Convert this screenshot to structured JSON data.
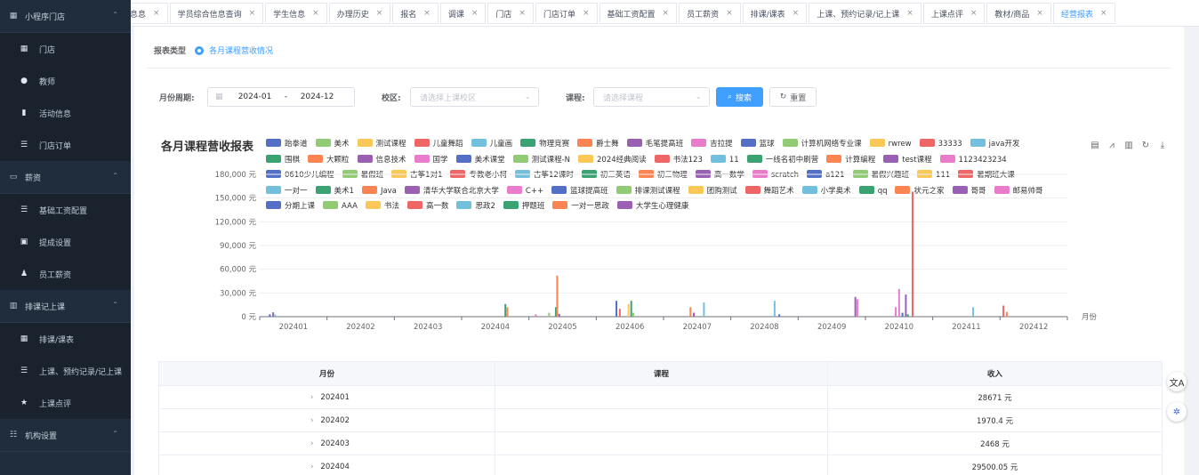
{
  "sidebar": {
    "items": [
      {
        "type": "group",
        "label": "小程序门店",
        "icon": "grid-icon",
        "chev": "⌃"
      },
      {
        "type": "item",
        "label": "门店",
        "icon": "table-icon"
      },
      {
        "type": "item",
        "label": "教师",
        "icon": "user-icon"
      },
      {
        "type": "item",
        "label": "活动信息",
        "icon": "info-icon"
      },
      {
        "type": "item",
        "label": "门店订单",
        "icon": "list-icon"
      },
      {
        "type": "group",
        "label": "薪资",
        "icon": "wallet-icon",
        "chev": "⌃"
      },
      {
        "type": "item",
        "label": "基础工资配置",
        "icon": "list-icon"
      },
      {
        "type": "item",
        "label": "提成设置",
        "icon": "doc-icon"
      },
      {
        "type": "item",
        "label": "员工薪资",
        "icon": "user-money-icon"
      },
      {
        "type": "group",
        "label": "排课记上课",
        "icon": "calendar-icon",
        "chev": "⌃"
      },
      {
        "type": "item",
        "label": "排课/课表",
        "icon": "grid-icon"
      },
      {
        "type": "item",
        "label": "上课、预约记录/记上课",
        "icon": "list-icon"
      },
      {
        "type": "item",
        "label": "上课点评",
        "icon": "star-icon"
      },
      {
        "type": "group",
        "label": "机构设置",
        "icon": "settings-icon",
        "chev": "⌃"
      }
    ]
  },
  "tabs": [
    {
      "label": "息息",
      "active": false
    },
    {
      "label": "学员综合信息查询",
      "active": false
    },
    {
      "label": "学生信息",
      "active": false
    },
    {
      "label": "办理历史",
      "active": false
    },
    {
      "label": "报名",
      "active": false
    },
    {
      "label": "调课",
      "active": false
    },
    {
      "label": "门店",
      "active": false
    },
    {
      "label": "门店订单",
      "active": false
    },
    {
      "label": "基础工资配置",
      "active": false
    },
    {
      "label": "员工薪资",
      "active": false
    },
    {
      "label": "排课/课表",
      "active": false
    },
    {
      "label": "上课、预约记录/记上课",
      "active": false
    },
    {
      "label": "上课点评",
      "active": false
    },
    {
      "label": "教材/商品",
      "active": false
    },
    {
      "label": "经营报表",
      "active": true
    }
  ],
  "report": {
    "type_label": "报表类型",
    "type_option": "各月课程营收情况",
    "period_label": "月份周期:",
    "period_start": "2024-01",
    "period_sep": "-",
    "period_end": "2024-12",
    "campus_label": "校区:",
    "campus_placeholder": "请选择上课校区",
    "course_label": "课程:",
    "course_placeholder": "请选择课程",
    "search_btn": "搜索",
    "reset_btn": "重置"
  },
  "chart_title": "各月课程营收报表",
  "chart_data": {
    "type": "bar",
    "categories": [
      "202401",
      "202402",
      "202403",
      "202404",
      "202405",
      "202406",
      "202407",
      "202408",
      "202409",
      "202410",
      "202411",
      "202412"
    ],
    "x_axis_name": "月份",
    "y_ticks": [
      "0 元",
      "30,000 元",
      "60,000 元",
      "90,000 元",
      "120,000 元",
      "150,000 元",
      "180,000 元"
    ],
    "ylim": [
      0,
      180000
    ],
    "legend": [
      {
        "name": "跆拳道",
        "color": "#5470c6"
      },
      {
        "name": "美术",
        "color": "#91cc75"
      },
      {
        "name": "测试课程",
        "color": "#fac858"
      },
      {
        "name": "儿童舞蹈",
        "color": "#ee6666"
      },
      {
        "name": "儿童画",
        "color": "#73c0de"
      },
      {
        "name": "物理竞赛",
        "color": "#3ba272"
      },
      {
        "name": "爵士舞",
        "color": "#fc8452"
      },
      {
        "name": "毛笔提高班",
        "color": "#9a60b4"
      },
      {
        "name": "吉拉提",
        "color": "#ea7ccc"
      },
      {
        "name": "篮球",
        "color": "#5470c6"
      },
      {
        "name": "计算机网络专业课",
        "color": "#91cc75"
      },
      {
        "name": "rwrew",
        "color": "#fac858"
      },
      {
        "name": "33333",
        "color": "#ee6666"
      },
      {
        "name": "java开发",
        "color": "#73c0de"
      },
      {
        "name": "围棋",
        "color": "#3ba272"
      },
      {
        "name": "大颗粒",
        "color": "#fc8452"
      },
      {
        "name": "信息技术",
        "color": "#9a60b4"
      },
      {
        "name": "国学",
        "color": "#ea7ccc"
      },
      {
        "name": "美术课堂",
        "color": "#5470c6"
      },
      {
        "name": "测试课程-N",
        "color": "#91cc75"
      },
      {
        "name": "2024经典阅读",
        "color": "#fac858"
      },
      {
        "name": "书法123",
        "color": "#ee6666"
      },
      {
        "name": "11",
        "color": "#73c0de"
      },
      {
        "name": "一线名初中刷营",
        "color": "#3ba272"
      },
      {
        "name": "计算编程",
        "color": "#fc8452"
      },
      {
        "name": "test课程",
        "color": "#9a60b4"
      },
      {
        "name": "1123423234",
        "color": "#ea7ccc"
      },
      {
        "name": "0610少儿编程",
        "color": "#5470c6"
      },
      {
        "name": "暑假班",
        "color": "#91cc75"
      },
      {
        "name": "古筝1对1",
        "color": "#fac858"
      },
      {
        "name": "专教老小柯",
        "color": "#ee6666"
      },
      {
        "name": "古筝12课时",
        "color": "#73c0de"
      },
      {
        "name": "初三英语",
        "color": "#3ba272"
      },
      {
        "name": "初三物理",
        "color": "#fc8452"
      },
      {
        "name": "高一数学",
        "color": "#9a60b4"
      },
      {
        "name": "scratch",
        "color": "#ea7ccc"
      },
      {
        "name": "a121",
        "color": "#5470c6"
      },
      {
        "name": "暑假兴趣班",
        "color": "#91cc75"
      },
      {
        "name": "111",
        "color": "#fac858"
      },
      {
        "name": "暑期班大课",
        "color": "#ee6666"
      },
      {
        "name": "一对一",
        "color": "#73c0de"
      },
      {
        "name": "美术1",
        "color": "#3ba272"
      },
      {
        "name": "Java",
        "color": "#fc8452"
      },
      {
        "name": "清华大学联合北京大学",
        "color": "#9a60b4"
      },
      {
        "name": "C++",
        "color": "#ea7ccc"
      },
      {
        "name": "篮球提高班",
        "color": "#5470c6"
      },
      {
        "name": "排课测试课程",
        "color": "#91cc75"
      },
      {
        "name": "团购测试",
        "color": "#fac858"
      },
      {
        "name": "舞蹈艺术",
        "color": "#ee6666"
      },
      {
        "name": "小学奥术",
        "color": "#73c0de"
      },
      {
        "name": "qq",
        "color": "#3ba272"
      },
      {
        "name": "状元之家",
        "color": "#fc8452"
      },
      {
        "name": "哥哥",
        "color": "#9a60b4"
      },
      {
        "name": "邮易帅哥",
        "color": "#ea7ccc"
      },
      {
        "name": "分期上课",
        "color": "#5470c6"
      },
      {
        "name": "AAA",
        "color": "#91cc75"
      },
      {
        "name": "书法",
        "color": "#fac858"
      },
      {
        "name": "高一数",
        "color": "#ee6666"
      },
      {
        "name": "思政2",
        "color": "#73c0de"
      },
      {
        "name": "押题班",
        "color": "#3ba272"
      },
      {
        "name": "一对一思政",
        "color": "#fc8452"
      },
      {
        "name": "大学生心理健康",
        "color": "#9a60b4"
      }
    ],
    "bars": [
      {
        "month_index": 0,
        "offset": -0.35,
        "value": 3000,
        "color": "#5470c6"
      },
      {
        "month_index": 0,
        "offset": -0.3,
        "value": 5500,
        "color": "#9a60b4"
      },
      {
        "month_index": 0,
        "offset": -0.27,
        "value": 2500,
        "color": "#73c0de"
      },
      {
        "month_index": 3,
        "offset": 0.15,
        "value": 16000,
        "color": "#3ba272"
      },
      {
        "month_index": 3,
        "offset": 0.18,
        "value": 12000,
        "color": "#fc8452"
      },
      {
        "month_index": 4,
        "offset": -0.4,
        "value": 3000,
        "color": "#ea7ccc"
      },
      {
        "month_index": 4,
        "offset": -0.2,
        "value": 5000,
        "color": "#91cc75"
      },
      {
        "month_index": 4,
        "offset": -0.1,
        "value": 2000,
        "color": "#5470c6"
      },
      {
        "month_index": 4,
        "offset": -0.05,
        "value": 3500,
        "color": "#9a60b4"
      },
      {
        "month_index": 4,
        "offset": -0.1,
        "value": 12000,
        "color": "#3ba272"
      },
      {
        "month_index": 4,
        "offset": -0.08,
        "value": 52000,
        "color": "#fc8452"
      },
      {
        "month_index": 5,
        "offset": -0.2,
        "value": 20000,
        "color": "#5470c6"
      },
      {
        "month_index": 5,
        "offset": -0.15,
        "value": 10000,
        "color": "#ee6666"
      },
      {
        "month_index": 5,
        "offset": -0.02,
        "value": 16000,
        "color": "#fac858"
      },
      {
        "month_index": 5,
        "offset": 0.02,
        "value": 20000,
        "color": "#3ba272"
      },
      {
        "month_index": 5,
        "offset": 0.05,
        "value": 5000,
        "color": "#91cc75"
      },
      {
        "month_index": 6,
        "offset": -0.1,
        "value": 12000,
        "color": "#fc8452"
      },
      {
        "month_index": 6,
        "offset": -0.05,
        "value": 5000,
        "color": "#9a60b4"
      },
      {
        "month_index": 6,
        "offset": 0.1,
        "value": 18000,
        "color": "#73c0de"
      },
      {
        "month_index": 7,
        "offset": 0.15,
        "value": 20000,
        "color": "#73c0de"
      },
      {
        "month_index": 7,
        "offset": 0.22,
        "value": 3000,
        "color": "#5470c6"
      },
      {
        "month_index": 8,
        "offset": 0.35,
        "value": 25000,
        "color": "#9a60b4"
      },
      {
        "month_index": 8,
        "offset": 0.38,
        "value": 22000,
        "color": "#ea7ccc"
      },
      {
        "month_index": 9,
        "offset": -0.05,
        "value": 12000,
        "color": "#ea7ccc"
      },
      {
        "month_index": 9,
        "offset": 0.0,
        "value": 35000,
        "color": "#ea7ccc"
      },
      {
        "month_index": 9,
        "offset": 0.05,
        "value": 5000,
        "color": "#5470c6"
      },
      {
        "month_index": 9,
        "offset": 0.1,
        "value": 28000,
        "color": "#9a60b4"
      },
      {
        "month_index": 9,
        "offset": 0.13,
        "value": 3000,
        "color": "#3ba272"
      },
      {
        "month_index": 9,
        "offset": 0.2,
        "value": 158000,
        "color": "#ee6666"
      },
      {
        "month_index": 10,
        "offset": 0.1,
        "value": 12000,
        "color": "#73c0de"
      },
      {
        "month_index": 10,
        "offset": 0.55,
        "value": 14000,
        "color": "#ee6666"
      },
      {
        "month_index": 10,
        "offset": 0.6,
        "value": 6000,
        "color": "#fc8452"
      }
    ]
  },
  "table": {
    "headers": [
      "月份",
      "课程",
      "收入"
    ],
    "rows": [
      {
        "month": "202401",
        "course": "",
        "income": "28671 元"
      },
      {
        "month": "202402",
        "course": "",
        "income": "1970.4 元"
      },
      {
        "month": "202403",
        "course": "",
        "income": "2468 元"
      },
      {
        "month": "202404",
        "course": "",
        "income": "29500.05 元"
      }
    ]
  },
  "float_buttons": [
    {
      "label": "文A",
      "icon": "translate-icon"
    },
    {
      "label": "✲",
      "icon": "network-icon"
    }
  ]
}
